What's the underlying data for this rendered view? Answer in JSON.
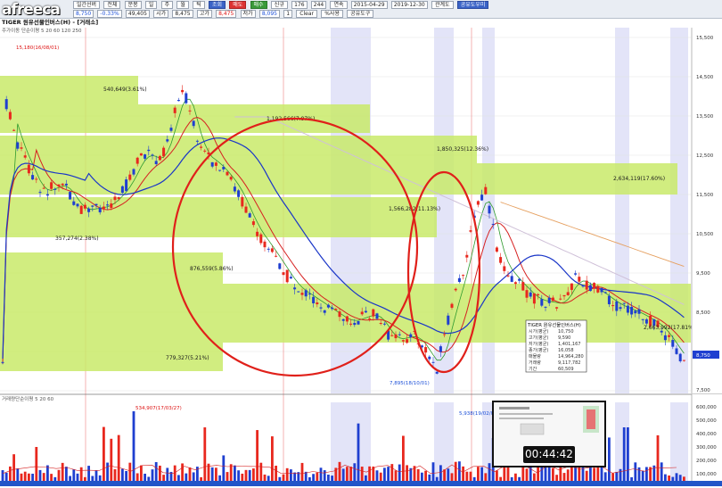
{
  "toolbar": {
    "logo": "afreeca",
    "row1": [
      "전체",
      "분봉",
      "일",
      "주",
      "월",
      "틱"
    ],
    "interval_label": "일간선버",
    "price": "8,750",
    "change": "-0.33%",
    "volume": "49,405",
    "open_label": "시가",
    "open": "8,475",
    "high_label": "고가",
    "high": "8,475",
    "low_label": "저가",
    "low": "8,095",
    "count1": "1",
    "field_a": "176",
    "field_b": "244",
    "period_label": "연속",
    "date_from": "2015-04-29",
    "date_to": "2019-12-30",
    "btn_inquire": "조회",
    "btn_sell": "매도",
    "btn_buy": "매수",
    "btn_trade": "신규",
    "btn_clear": "Clear",
    "btn_pct": "%사용",
    "btn_tools": "공유도구",
    "btn_bookmark": "관계도",
    "btn_save": "공유도우미"
  },
  "chart_labels": {
    "title": "TIGER 원유선물인버스(H) - [거래소]",
    "ma_legend": "주가이동 단순이평 5 20 60 120 250",
    "vol_legend": "거래량단순이평 5 20 60",
    "high_marker": "15,180(16/08/01)",
    "low_marker": "7,895(18/10/01)",
    "vol_peak1": "534,907(17/03/27)",
    "vol_peak2": "5,938(19/02/07)"
  },
  "zone_labels": [
    "540,649(3.61%)",
    "1,192,566(7.97%)",
    "357,274(2.38%)",
    "1,850,325(12.36%)",
    "1,566,282(11.13%)",
    "2,634,119(17.60%)",
    "876,559(5.86%)",
    "779,327(5.21%)",
    "2,663,992(17.81%)"
  ],
  "price_axis": [
    "15,500",
    "14,500",
    "13,500",
    "12,500",
    "11,500",
    "10,500",
    "9,500",
    "8,500",
    "7,500"
  ],
  "price_axis_top": "15,500",
  "current_price_tag": "8,750",
  "vol_axis": [
    "600,000",
    "500,000",
    "400,000",
    "300,000",
    "200,000",
    "100,000"
  ],
  "info_box": {
    "title": "TIGER 원유선물인버스(H)",
    "rows": [
      {
        "k": "시가(평균)",
        "v": "10,750"
      },
      {
        "k": "고가(평균)",
        "v": "9,590"
      },
      {
        "k": "저가(평균)",
        "v": "1,401,167"
      },
      {
        "k": "종가(평균)",
        "v": "16,058"
      },
      {
        "k": "매물량",
        "v": "14,964,280"
      },
      {
        "k": "거래량",
        "v": "9,117,782"
      },
      {
        "k": "기간",
        "v": "60,509"
      }
    ]
  },
  "video": {
    "timestamp": "00:44:42"
  },
  "colors": {
    "up": "#e8281e",
    "down": "#1f3fd0",
    "zone": "#c9ea6a",
    "ring": "#e0201a",
    "shade": "#e3e4f8"
  }
}
